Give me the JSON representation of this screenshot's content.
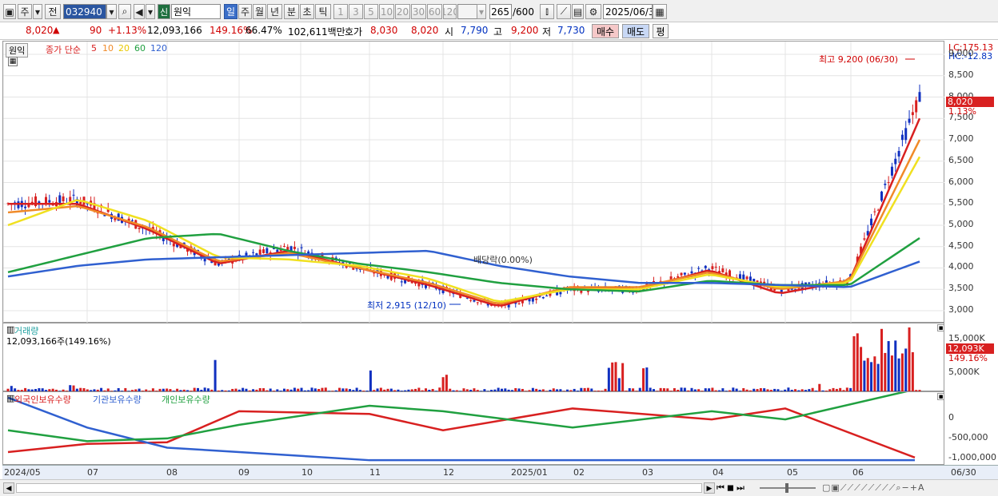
{
  "toolbar": {
    "code_prefix": "주",
    "prev_btn": "전",
    "code": "032940",
    "new_badge": "신",
    "name": "원익",
    "periods": [
      "일",
      "주",
      "월",
      "년",
      "분",
      "초",
      "틱"
    ],
    "minutes": [
      "1",
      "3",
      "5",
      "10",
      "20",
      "30",
      "60",
      "120"
    ],
    "count": "265",
    "count_max": "/600",
    "date": "2025/06/30"
  },
  "quote": {
    "price": "8,020",
    "arrow": "▲",
    "change": "90",
    "change_pct": "+1.13%",
    "volume": "12,093,166",
    "volume_pct": "149.16%",
    "turnover_pct": "66.47%",
    "amount": "102,611백만",
    "ask_label": "호가",
    "ask": "8,030",
    "bid": "8,020",
    "open_label": "시",
    "open": "7,790",
    "high_label": "고",
    "high": "9,200",
    "low_label": "저",
    "low": "7,730",
    "buy_label": "매수",
    "sell_label": "매도",
    "avg_label": "평"
  },
  "price_panel": {
    "name": "원익",
    "legend_prefix": "종가 단순",
    "ma": [
      {
        "label": "5",
        "color": "#d82020"
      },
      {
        "label": "10",
        "color": "#f08a28"
      },
      {
        "label": "20",
        "color": "#f0e020"
      },
      {
        "label": "60",
        "color": "#20a040"
      },
      {
        "label": "120",
        "color": "#3060d0"
      }
    ],
    "lc": "LC:175.13",
    "hc": "HC:-12.83",
    "ticks": [
      "9,000",
      "8,500",
      "8,000",
      "7,500",
      "7,000",
      "6,500",
      "6,000",
      "5,500",
      "5,000",
      "4,500",
      "4,000",
      "3,500",
      "3,000"
    ],
    "current_price": "8,020",
    "current_pct": "1.13%",
    "high_note": "최고 9,200 (06/30)",
    "low_note": "최저 2,915 (12/10)",
    "dividend_note": "배당락(0.00%)"
  },
  "volume_panel": {
    "title": "거래량",
    "value": "12,093,166주(149.16%)",
    "ticks": [
      "15,000K",
      "5,000K"
    ],
    "current": "12,093K",
    "current_pct": "149.16%"
  },
  "holder_panel": {
    "series": [
      {
        "name": "외국인보유수량",
        "color": "#d82020"
      },
      {
        "name": "기관보유수량",
        "color": "#3060d0"
      },
      {
        "name": "개인보유수량",
        "color": "#20a040"
      }
    ],
    "ticks": [
      "0",
      "-500,000",
      "-1,000,000"
    ]
  },
  "xaxis": {
    "labels": [
      "2024/05",
      "07",
      "08",
      "09",
      "10",
      "11",
      "12",
      "2025/01",
      "02",
      "03",
      "04",
      "05",
      "06"
    ],
    "right": "06/30"
  },
  "chart_data": [
    {
      "type": "candlestick",
      "title": "원익",
      "ylim": [
        2700,
        9300
      ],
      "x": [
        "2024/05",
        "2024/06",
        "2024/07",
        "2024/08",
        "2024/09",
        "2024/10",
        "2024/11",
        "2024/12",
        "2025/01",
        "2025/02",
        "2025/03",
        "2025/04",
        "2025/05",
        "2025/06"
      ],
      "close": [
        5500,
        5600,
        4900,
        4100,
        4500,
        4000,
        3600,
        3100,
        3500,
        3500,
        4000,
        3500,
        3700,
        8020
      ],
      "series": [
        {
          "name": "5",
          "values": [
            5500,
            5500,
            4900,
            4100,
            4400,
            4000,
            3600,
            3100,
            3550,
            3500,
            3950,
            3400,
            3700,
            7500
          ]
        },
        {
          "name": "10",
          "values": [
            5300,
            5450,
            4950,
            4150,
            4350,
            4000,
            3650,
            3150,
            3550,
            3550,
            3900,
            3500,
            3700,
            7000
          ]
        },
        {
          "name": "20",
          "values": [
            5000,
            5600,
            5100,
            4250,
            4200,
            4050,
            3750,
            3200,
            3500,
            3500,
            3850,
            3550,
            3650,
            6600
          ]
        },
        {
          "name": "60",
          "values": [
            3900,
            4300,
            4700,
            4800,
            4400,
            4100,
            3900,
            3650,
            3500,
            3450,
            3700,
            3600,
            3600,
            4700
          ]
        },
        {
          "name": "120",
          "values": [
            3800,
            4050,
            4200,
            4250,
            4300,
            4350,
            4400,
            4050,
            3800,
            3650,
            3650,
            3600,
            3550,
            4150
          ]
        }
      ]
    },
    {
      "type": "bar",
      "title": "거래량",
      "x": [
        "2024/05",
        "2024/07",
        "2024/08",
        "2024/11",
        "2024/12",
        "2025/02",
        "2025/03",
        "2025/05",
        "2025/06"
      ],
      "values": [
        3500,
        2000,
        10000,
        8000,
        9000,
        8500,
        7000,
        3000,
        17000
      ],
      "ylim": [
        0,
        17000
      ]
    },
    {
      "type": "line",
      "x": [
        "2024/05",
        "2024/07",
        "2024/08",
        "2024/09",
        "2024/11",
        "2024/12",
        "2025/02",
        "2025/04",
        "2025/05",
        "2025/06"
      ],
      "ylim": [
        -1150000,
        200000
      ],
      "series": [
        {
          "name": "외국인보유수량",
          "values": [
            -900000,
            -750000,
            -720000,
            -150000,
            -200000,
            -500000,
            -100000,
            -300000,
            -100000,
            -1000000
          ]
        },
        {
          "name": "기관보유수량",
          "values": [
            100000,
            -450000,
            -820000,
            -900000,
            -1050000,
            -1050000,
            -1050000,
            -1050000,
            -1050000,
            -1050000
          ]
        },
        {
          "name": "개인보유수량",
          "values": [
            -500000,
            -700000,
            -650000,
            -400000,
            -50000,
            -150000,
            -450000,
            -150000,
            -300000,
            250000
          ]
        }
      ]
    }
  ]
}
